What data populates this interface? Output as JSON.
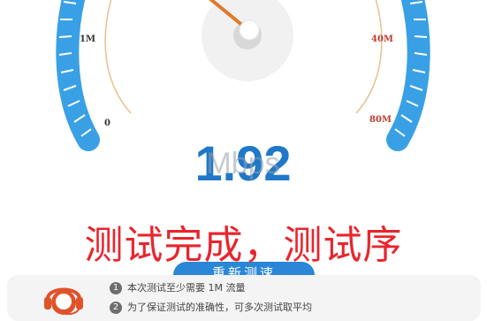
{
  "gauge": {
    "scale_labels": {
      "left_upper": "1M",
      "left_lower": "0",
      "right_upper": "40M",
      "right_lower": "80M"
    },
    "colors": {
      "arc": "#3aa0e6",
      "scale_line": "#e8c08a",
      "needle": "#e07a2c",
      "low_labels": "#333333",
      "high_labels": "#c0392b"
    }
  },
  "result": {
    "speed_value": "1.92",
    "speed_unit": "Mbps"
  },
  "caption": "测试完成，测试序",
  "retest_button": "重新测速",
  "tips": [
    {
      "number": "1",
      "text": "本次测试至少需要 1M 流量"
    },
    {
      "number": "2",
      "text": "为了保证测试的准确性，可多次测试取平均"
    }
  ],
  "icons": {
    "support": "customer-service-headset-icon"
  }
}
